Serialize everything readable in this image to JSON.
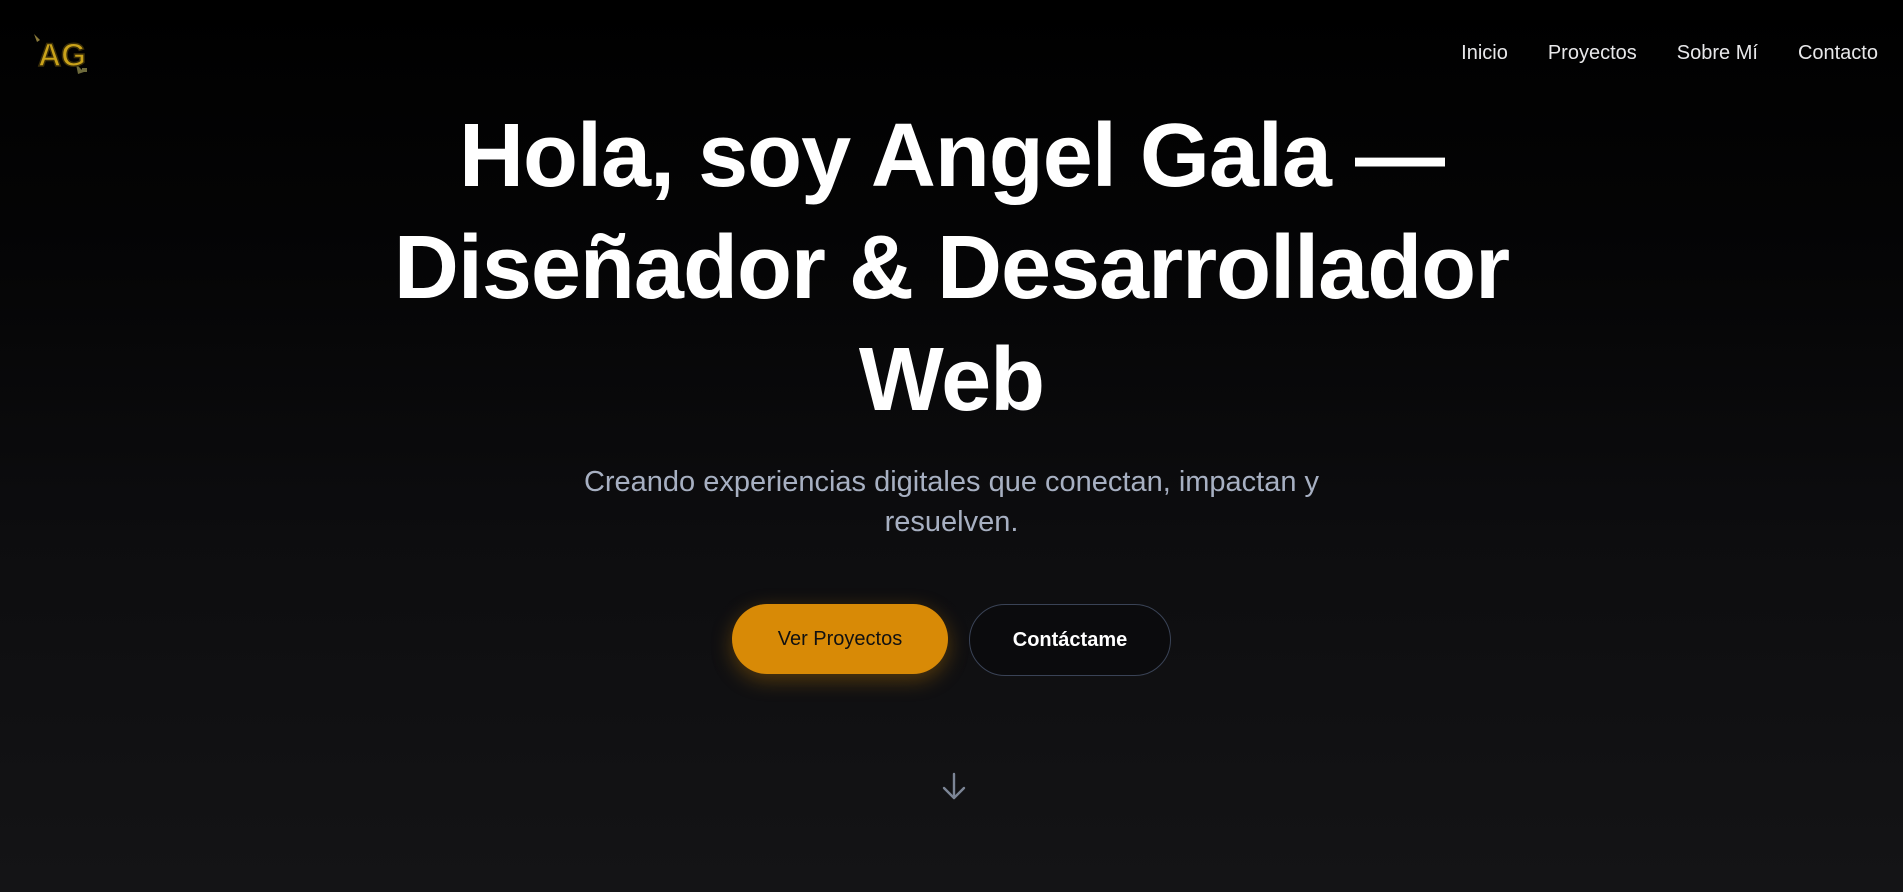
{
  "nav": {
    "logo_text": "AG",
    "links": [
      {
        "label": "Inicio"
      },
      {
        "label": "Proyectos"
      },
      {
        "label": "Sobre Mí"
      },
      {
        "label": "Contacto"
      }
    ]
  },
  "hero": {
    "title_line1": "Hola, soy Angel Gala —",
    "title_line2": "Diseñador & Desarrollador",
    "title_line3": "Web",
    "subtitle": "Creando experiencias digitales que conectan, impactan y resuelven.",
    "primary_button": "Ver Proyectos",
    "secondary_button": "Contáctame"
  },
  "icons": {
    "logo": "ag-logo-icon",
    "scroll": "arrow-down-icon"
  },
  "colors": {
    "accent": "#d88a06",
    "subtitle": "#a7b0c2",
    "background_top": "#000000",
    "background_bottom": "#141416"
  }
}
